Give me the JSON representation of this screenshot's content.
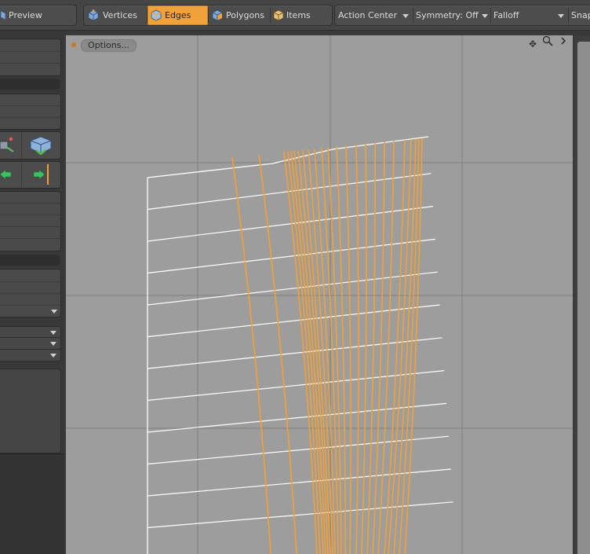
{
  "toolbar": {
    "preview_label": "Preview",
    "modes": [
      {
        "label": "Vertices",
        "active": false
      },
      {
        "label": "Edges",
        "active": true
      },
      {
        "label": "Polygons",
        "active": false
      },
      {
        "label": "Items",
        "active": false
      }
    ],
    "action_center_label": "Action Center",
    "symmetry_label": "Symmetry: Off",
    "falloff_label": "Falloff",
    "snap_label": "Snap"
  },
  "viewport": {
    "options_label": "Options...",
    "icons": [
      "move-view-icon",
      "zoom-view-icon",
      "expand-arrow-icon"
    ]
  },
  "colors": {
    "accent": "#f0a13a",
    "viewport_bg": "#9d9d9d",
    "wire": "#ffffff",
    "selected_edge": "#f5a033"
  }
}
